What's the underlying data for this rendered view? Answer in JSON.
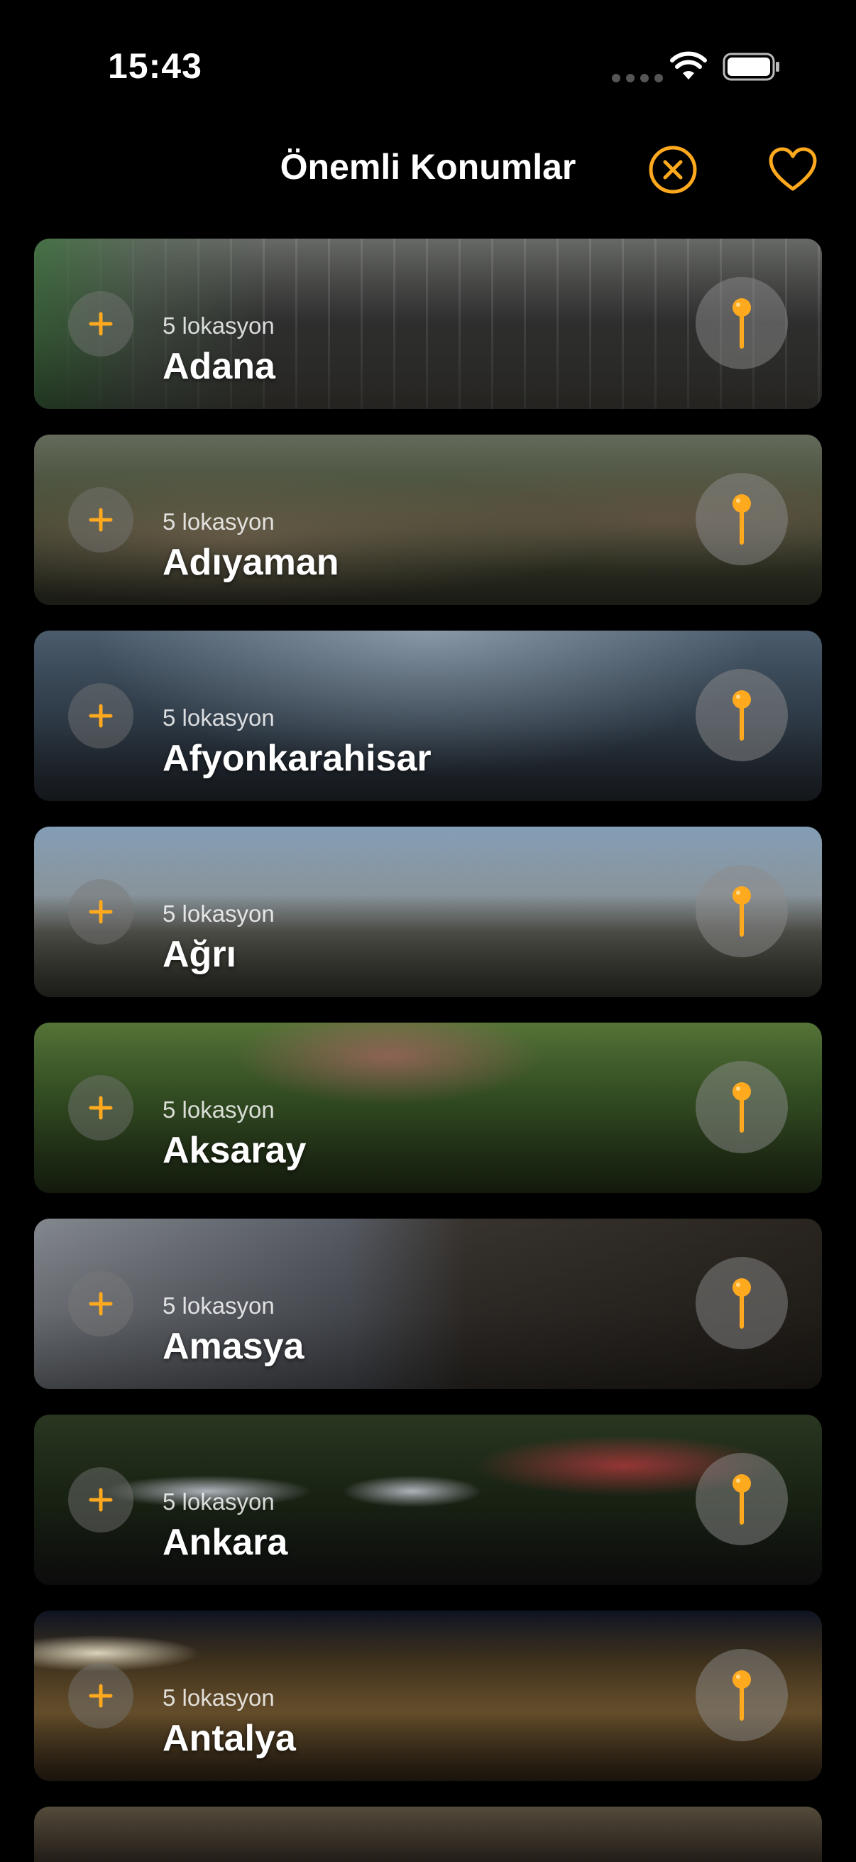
{
  "status": {
    "time": "15:43"
  },
  "nav": {
    "title": "Önemli Konumlar"
  },
  "colors": {
    "accent": "#FFA91E",
    "background": "#000000"
  },
  "icons": {
    "close": "xmark-circle-icon",
    "favorite": "heart-icon",
    "add": "plus-icon",
    "pin": "map-pin-icon"
  },
  "cities": [
    {
      "name": "Adana",
      "subtitle": "5 lokasyon"
    },
    {
      "name": "Adıyaman",
      "subtitle": "5 lokasyon"
    },
    {
      "name": "Afyonkarahisar",
      "subtitle": "5 lokasyon"
    },
    {
      "name": "Ağrı",
      "subtitle": "5 lokasyon"
    },
    {
      "name": "Aksaray",
      "subtitle": "5 lokasyon"
    },
    {
      "name": "Amasya",
      "subtitle": "5 lokasyon"
    },
    {
      "name": "Ankara",
      "subtitle": "5 lokasyon"
    },
    {
      "name": "Antalya",
      "subtitle": "5 lokasyon"
    }
  ]
}
